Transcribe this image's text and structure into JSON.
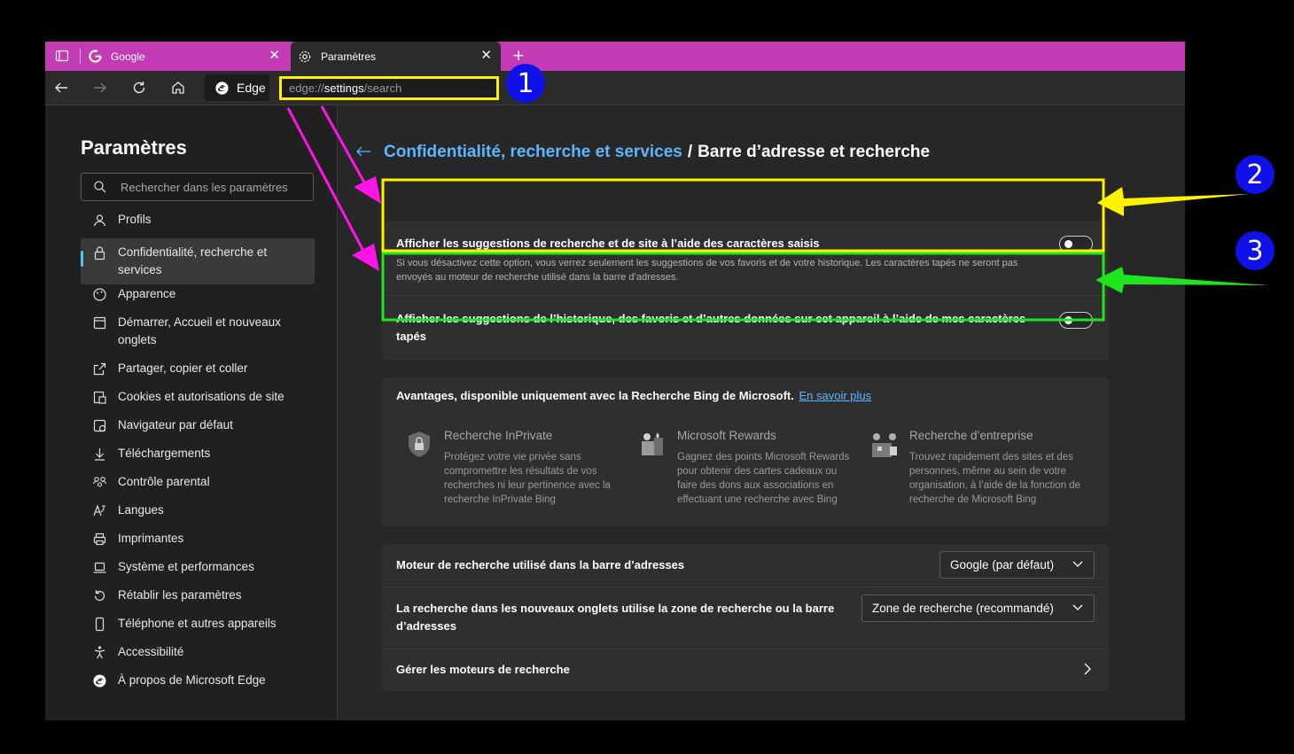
{
  "tabs": [
    {
      "title": "Google",
      "icon": "google-icon"
    },
    {
      "title": "Paramètres",
      "icon": "gear-icon"
    }
  ],
  "toolbar": {
    "edge_label": "Edge",
    "address_prefix": "edge://",
    "address_path": "settings",
    "address_suffix": "/search"
  },
  "sidebar": {
    "title": "Paramètres",
    "search_placeholder": "Rechercher dans les paramètres",
    "items": [
      {
        "label": "Profils",
        "icon": "profile-icon"
      },
      {
        "label": "Confidentialité, recherche et services",
        "icon": "lock-icon",
        "active": true
      },
      {
        "label": "Apparence",
        "icon": "palette-icon"
      },
      {
        "label": "Démarrer, Accueil et nouveaux onglets",
        "icon": "home-tabs-icon"
      },
      {
        "label": "Partager, copier et coller",
        "icon": "share-icon"
      },
      {
        "label": "Cookies et autorisations de site",
        "icon": "cookies-icon"
      },
      {
        "label": "Navigateur par défaut",
        "icon": "browser-icon"
      },
      {
        "label": "Téléchargements",
        "icon": "download-icon"
      },
      {
        "label": "Contrôle parental",
        "icon": "family-icon"
      },
      {
        "label": "Langues",
        "icon": "language-icon"
      },
      {
        "label": "Imprimantes",
        "icon": "printer-icon"
      },
      {
        "label": "Système et performances",
        "icon": "laptop-icon"
      },
      {
        "label": "Rétablir les paramètres",
        "icon": "reset-icon"
      },
      {
        "label": "Téléphone et autres appareils",
        "icon": "phone-icon"
      },
      {
        "label": "Accessibilité",
        "icon": "accessibility-icon"
      },
      {
        "label": "À propos de Microsoft Edge",
        "icon": "edge-icon"
      }
    ]
  },
  "main": {
    "breadcrumb_parent": "Confidentialité, recherche et services",
    "breadcrumb_separator": "/",
    "breadcrumb_current": "Barre d’adresse et recherche",
    "toggle1": {
      "title": "Afficher les suggestions de recherche et de site à l’aide des caractères saisis",
      "desc": "Si vous désactivez cette option, vous verrez seulement les suggestions de vos favoris et de votre historique. Les caractères tapés ne seront pas envoyés au moteur de recherche utilisé dans la barre d’adresses.",
      "on": false
    },
    "toggle2": {
      "title": "Afficher les suggestions de l’historique, des favoris et d’autres données sur cet appareil à l’aide de mes caractères tapés",
      "on": false
    },
    "bing": {
      "title": "Avantages, disponible uniquement avec la Recherche Bing de Microsoft.",
      "link": "En savoir plus",
      "features": [
        {
          "title": "Recherche InPrivate",
          "desc": "Protégez votre vie privée sans compromettre les résultats de vos recherches ni leur pertinence avec la recherche InPrivate Bing",
          "icon": "shield-lock-icon"
        },
        {
          "title": "Microsoft Rewards",
          "desc": "Gagnez des points Microsoft Rewards pour obtenir des cartes cadeaux ou faire des dons aux associations en effectuant une recherche avec Bing",
          "icon": "rewards-icon"
        },
        {
          "title": "Recherche d’entreprise",
          "desc": "Trouvez rapidement des sites et des personnes, même au sein de votre organisation, à l’aide de la fonction de recherche de Microsoft Bing",
          "icon": "enterprise-icon"
        }
      ]
    },
    "engine": {
      "label": "Moteur de recherche utilisé dans la barre d’adresses",
      "value": "Google (par défaut)"
    },
    "newtab": {
      "label": "La recherche dans les nouveaux onglets utilise la zone de recherche ou la barre d’adresses",
      "value": "Zone de recherche (recommandé)"
    },
    "manage": {
      "label": "Gérer les moteurs de recherche"
    }
  },
  "annotations": {
    "badges": [
      "1",
      "2",
      "3"
    ],
    "colors": {
      "yellow": "#fff200",
      "green": "#1ee51e",
      "magenta": "#ff14e8",
      "badge": "#1010e8"
    }
  }
}
